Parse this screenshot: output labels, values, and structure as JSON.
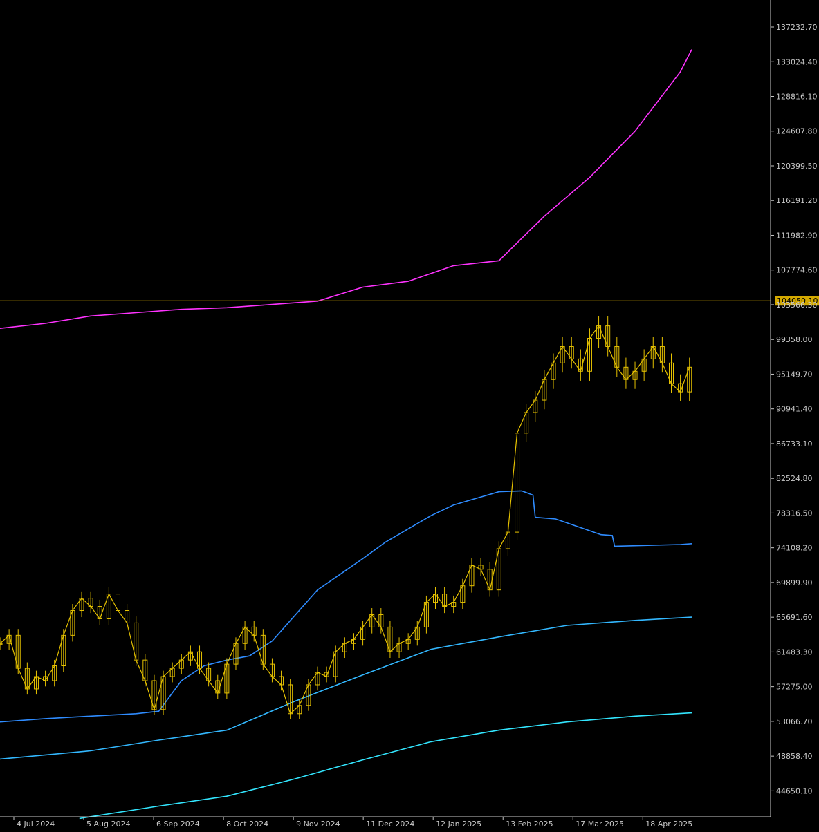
{
  "chart_data": {
    "type": "line",
    "instrument": "",
    "timeframe": "D1",
    "price_axis": {
      "labels": [
        "137232.70",
        "133024.40",
        "128816.10",
        "124607.80",
        "120399.50",
        "116191.20",
        "111982.90",
        "107774.60",
        "103566.30",
        "99358.00",
        "95149.70",
        "90941.40",
        "86733.10",
        "82524.80",
        "78316.50",
        "74108.20",
        "69899.90",
        "65691.60",
        "61483.30",
        "57275.00",
        "53066.70",
        "48858.40",
        "44650.10"
      ],
      "range": [
        41500,
        140500
      ]
    },
    "time_axis": {
      "labels": [
        "4 Jul 2024",
        "5 Aug 2024",
        "6 Sep 2024",
        "8 Oct 2024",
        "9 Nov 2024",
        "11 Dec 2024",
        "12 Jan 2025",
        "13 Feb 2025",
        "17 Mar 2025",
        "18 Apr 2025"
      ]
    },
    "current_price": {
      "value": 104050.1,
      "label": "104050.10",
      "color": "#d4a900"
    },
    "price_series": {
      "name": "",
      "style": "candlestick-like",
      "color": "#e6c200",
      "x": [
        0,
        4,
        8,
        12,
        16,
        20,
        24,
        28,
        32,
        36,
        40,
        44,
        48,
        52,
        56,
        60,
        64,
        68,
        72,
        76,
        80,
        84,
        88,
        92,
        96,
        100,
        104,
        108,
        112,
        116,
        120,
        124,
        128,
        132,
        136,
        140,
        144,
        148,
        152,
        156,
        160,
        164,
        168,
        172,
        176,
        180,
        184,
        188,
        192,
        196,
        200,
        204,
        208,
        212,
        216,
        220,
        224,
        228,
        232,
        236,
        240,
        244,
        248,
        252,
        256,
        260,
        264,
        268,
        272,
        276,
        280,
        284,
        288,
        292,
        296,
        300,
        304
      ],
      "values": [
        62500,
        63500,
        59500,
        57000,
        58500,
        58000,
        59800,
        63500,
        66500,
        68000,
        67000,
        65500,
        68500,
        66500,
        65000,
        60500,
        58000,
        54500,
        58500,
        59500,
        60500,
        61500,
        59500,
        58000,
        56500,
        60000,
        62500,
        64500,
        63500,
        60000,
        58500,
        57500,
        54000,
        55000,
        57500,
        59000,
        58500,
        61500,
        62500,
        63000,
        64500,
        66000,
        64500,
        61500,
        62500,
        63000,
        64500,
        67500,
        68500,
        67000,
        67500,
        69500,
        72000,
        71500,
        69000,
        74000,
        76000,
        88000,
        90500,
        92000,
        94500,
        96500,
        98500,
        97000,
        95500,
        99500,
        101000,
        98500,
        96000,
        94500,
        95500,
        97000,
        98500,
        96500,
        94000,
        93000,
        96000
      ]
    },
    "series": [
      {
        "name": "",
        "color": "#ff33ff",
        "x": [
          0,
          20,
          40,
          60,
          80,
          100,
          120,
          140,
          160,
          180,
          200,
          220,
          240,
          260,
          280,
          300,
          305
        ],
        "values": [
          100700,
          101300,
          102200,
          102600,
          103000,
          103200,
          103600,
          104000,
          105700,
          106400,
          108300,
          108900,
          114300,
          119000,
          124600,
          131800,
          134500
        ]
      },
      {
        "name": "",
        "color": "#2f8cff",
        "x": [
          0,
          20,
          40,
          60,
          70,
          80,
          90,
          100,
          110,
          120,
          140,
          160,
          170,
          180,
          190,
          200,
          210,
          220,
          230,
          235,
          236,
          245,
          265,
          270,
          271,
          300,
          305
        ],
        "values": [
          53000,
          53400,
          53700,
          54000,
          54300,
          58000,
          59800,
          60500,
          61000,
          62800,
          69000,
          72800,
          74800,
          76400,
          78000,
          79300,
          80100,
          80900,
          81000,
          80500,
          77800,
          77600,
          75700,
          75600,
          74300,
          74500,
          74600
        ]
      },
      {
        "name": "",
        "color": "#33b8ff",
        "x": [
          0,
          40,
          70,
          100,
          130,
          160,
          190,
          220,
          250,
          280,
          305
        ],
        "values": [
          48500,
          49500,
          50800,
          52000,
          55500,
          58700,
          61800,
          63300,
          64700,
          65300,
          65700
        ]
      },
      {
        "name": "",
        "color": "#33e6ff",
        "x": [
          35,
          70,
          100,
          130,
          160,
          190,
          220,
          250,
          280,
          305
        ],
        "values": [
          41300,
          42800,
          44000,
          46100,
          48400,
          50600,
          52000,
          53000,
          53700,
          54100
        ]
      }
    ],
    "grid": false,
    "legend": "none",
    "colors": {
      "background": "#000000",
      "axis": "#c8c8c8",
      "axis_text": "#c8c8c8"
    }
  }
}
